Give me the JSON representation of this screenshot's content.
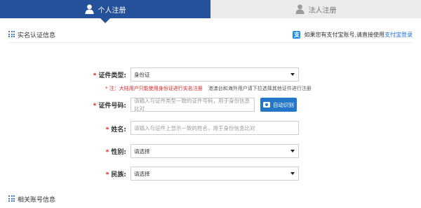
{
  "tabs": {
    "personal": "个人注册",
    "legal": "法人注册"
  },
  "section1": {
    "title": "实名认证信息",
    "alipay_hint": "如果您有支付宝账号,请直接使用",
    "alipay_link": "支付宝登录"
  },
  "form": {
    "id_type": {
      "label": "证件类型:",
      "value": "身份证"
    },
    "note": {
      "red": "* 注：大陆用户只能使用身份证进行实名注册",
      "gray": "港澳台和海外用户请下拉选择其他证件进行注册"
    },
    "id_number": {
      "label": "证件号码:",
      "placeholder": "请输入与证件类型一致的证件号码，用于身份信息比对",
      "scan_button": "自动识别"
    },
    "name": {
      "label": "姓名:",
      "placeholder": "请输入与证件上显示一致的姓名，用于身份信息比对"
    },
    "gender": {
      "label": "性别:",
      "value": "请选择"
    },
    "ethnic": {
      "label": "民族:",
      "value": "请选择"
    }
  },
  "section2": {
    "title": "相关账号信息"
  },
  "colors": {
    "brand": "#25509a",
    "accent_button": "#2477c8",
    "required": "#dd2222",
    "link": "#1b6fd0"
  },
  "icons": {
    "personal_tab": "user-icon",
    "legal_tab": "user-icon",
    "alipay": "alipay-icon",
    "scan": "camera-icon",
    "section": "grid-icon",
    "select": "chevron-down-icon"
  }
}
